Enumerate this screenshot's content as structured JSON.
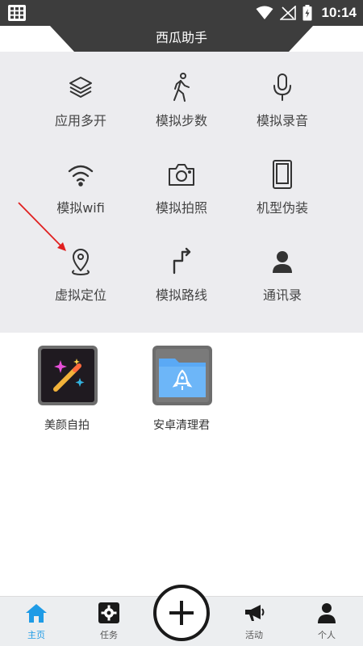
{
  "status_bar": {
    "time": "10:14",
    "icons": [
      "grid-icon",
      "wifi-icon",
      "signal-off-icon",
      "battery-icon"
    ]
  },
  "header": {
    "title": "西瓜助手"
  },
  "features": [
    {
      "icon": "layers-icon",
      "label": "应用多开"
    },
    {
      "icon": "walking-icon",
      "label": "模拟步数"
    },
    {
      "icon": "microphone-icon",
      "label": "模拟录音"
    },
    {
      "icon": "wifi-icon",
      "label": "模拟wifi"
    },
    {
      "icon": "camera-icon",
      "label": "模拟拍照"
    },
    {
      "icon": "phone-device-icon",
      "label": "机型伪装"
    },
    {
      "icon": "location-pin-icon",
      "label": "虚拟定位"
    },
    {
      "icon": "route-icon",
      "label": "模拟路线"
    },
    {
      "icon": "contact-icon",
      "label": "通讯录"
    }
  ],
  "apps": [
    {
      "icon": "magic-wand-icon",
      "label": "美颜自拍"
    },
    {
      "icon": "rocket-folder-icon",
      "label": "安卓清理君"
    }
  ],
  "bottom_nav": [
    {
      "icon": "home-icon",
      "label": "主页",
      "active": true
    },
    {
      "icon": "gear-icon",
      "label": "任务",
      "active": false
    },
    {
      "icon": "megaphone-icon",
      "label": "活动",
      "active": false
    },
    {
      "icon": "person-icon",
      "label": "个人",
      "active": false
    }
  ],
  "colors": {
    "status_bar": "#3d3d3d",
    "panel": "#ececef",
    "active_tab": "#1e9be6",
    "arrow": "#e02020",
    "folder_blue": "#5aa9f5"
  }
}
